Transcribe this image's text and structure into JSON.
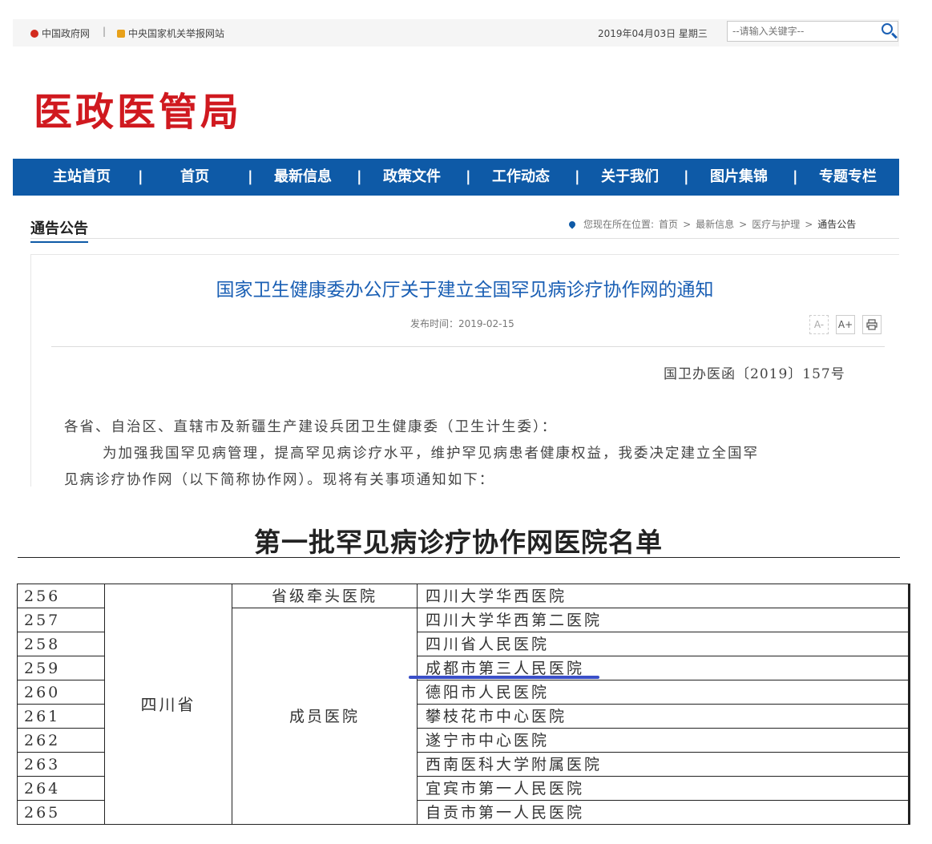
{
  "topbar": {
    "link1": "中国政府网",
    "separator": "|",
    "link2": "中央国家机关举报网站",
    "date": "2019年04月03日 星期三",
    "search_placeholder": "--请输入关键字--"
  },
  "site_logo": "医政医管局",
  "nav": {
    "items": [
      "主站首页",
      "首页",
      "最新信息",
      "政策文件",
      "工作动态",
      "关于我们",
      "图片集锦",
      "专题专栏"
    ],
    "separator": "|"
  },
  "section": {
    "title": "通告公告",
    "breadcrumb_prefix": "您现在所在位置:",
    "breadcrumb": [
      "首页",
      "最新信息",
      "医疗与护理",
      "通告公告"
    ],
    "breadcrumb_sep": ">"
  },
  "article": {
    "title": "国家卫生健康委办公厅关于建立全国罕见病诊疗协作网的通知",
    "publish_label": "发布时间：2019-02-15",
    "doc_number": "国卫办医函〔2019〕157号",
    "paragraphs": [
      "各省、自治区、直辖市及新疆生产建设兵团卫生健康委（卫生计生委）：",
      "为加强我国罕见病管理，提高罕见病诊疗水平，维护罕见病患者健康权益，我委决定建立全国罕",
      "见病诊疗协作网（以下简称协作网）。现将有关事项通知如下："
    ],
    "tools": {
      "font_smaller": "A-",
      "font_larger": "A+",
      "print": "print"
    }
  },
  "hospital_list": {
    "title": "第一批罕见病诊疗协作网医院名单",
    "province": "四川省",
    "lead_role": "省级牵头医院",
    "member_role": "成员医院",
    "rows": [
      {
        "no": "256",
        "name": "四川大学华西医院"
      },
      {
        "no": "257",
        "name": "四川大学华西第二医院"
      },
      {
        "no": "258",
        "name": "四川省人民医院"
      },
      {
        "no": "259",
        "name": "成都市第三人民医院"
      },
      {
        "no": "260",
        "name": "德阳市人民医院"
      },
      {
        "no": "261",
        "name": "攀枝花市中心医院"
      },
      {
        "no": "262",
        "name": "遂宁市中心医院"
      },
      {
        "no": "263",
        "name": "西南医科大学附属医院"
      },
      {
        "no": "264",
        "name": "宜宾市第一人民医院"
      },
      {
        "no": "265",
        "name": "自贡市第一人民医院"
      }
    ],
    "highlight_color": "#3a4fc8"
  },
  "colors": {
    "nav_bg": "#0e5aa7",
    "logo_red": "#d0191f",
    "title_blue": "#1a5fb4"
  }
}
